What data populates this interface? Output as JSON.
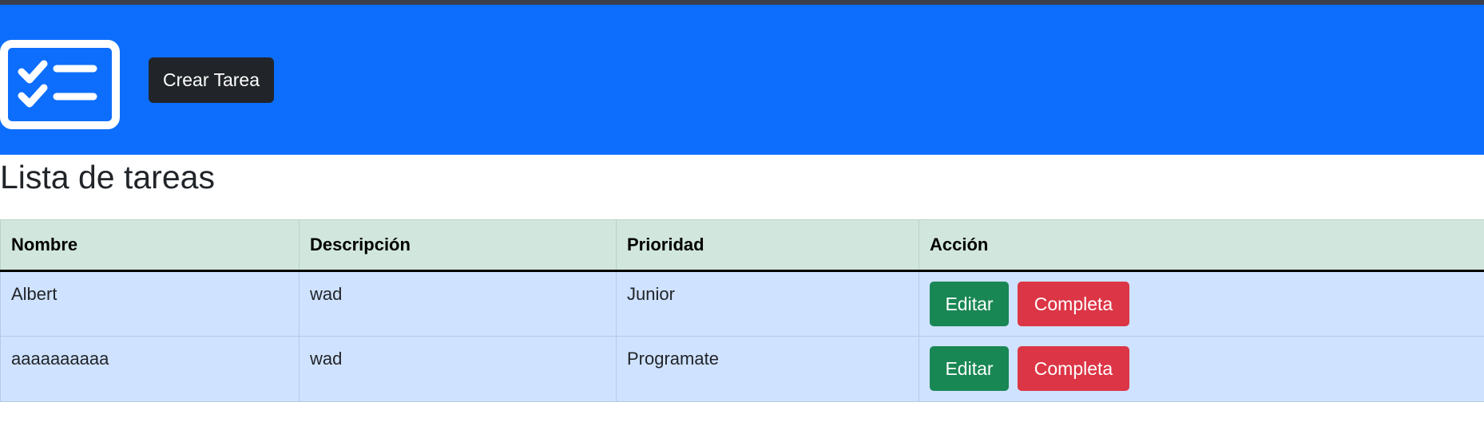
{
  "navbar": {
    "logo_icon": "checklist-icon",
    "create_button_label": "Crear Tarea",
    "background_color": "#0d6efd"
  },
  "page": {
    "title": "Lista de tareas"
  },
  "table": {
    "headers": [
      "Nombre",
      "Descripción",
      "Prioridad",
      "Acción"
    ],
    "rows": [
      {
        "nombre": "Albert",
        "descripcion": "wad",
        "prioridad": "Junior",
        "edit_label": "Editar",
        "complete_label": "Completa"
      },
      {
        "nombre": "aaaaaaaaaa",
        "descripcion": "wad",
        "prioridad": "Programate",
        "edit_label": "Editar",
        "complete_label": "Completa"
      }
    ]
  },
  "colors": {
    "header_row": "#d1e7dd",
    "body_row": "#cfe2ff",
    "edit_button": "#198754",
    "complete_button": "#dc3545",
    "create_button": "#212529"
  }
}
